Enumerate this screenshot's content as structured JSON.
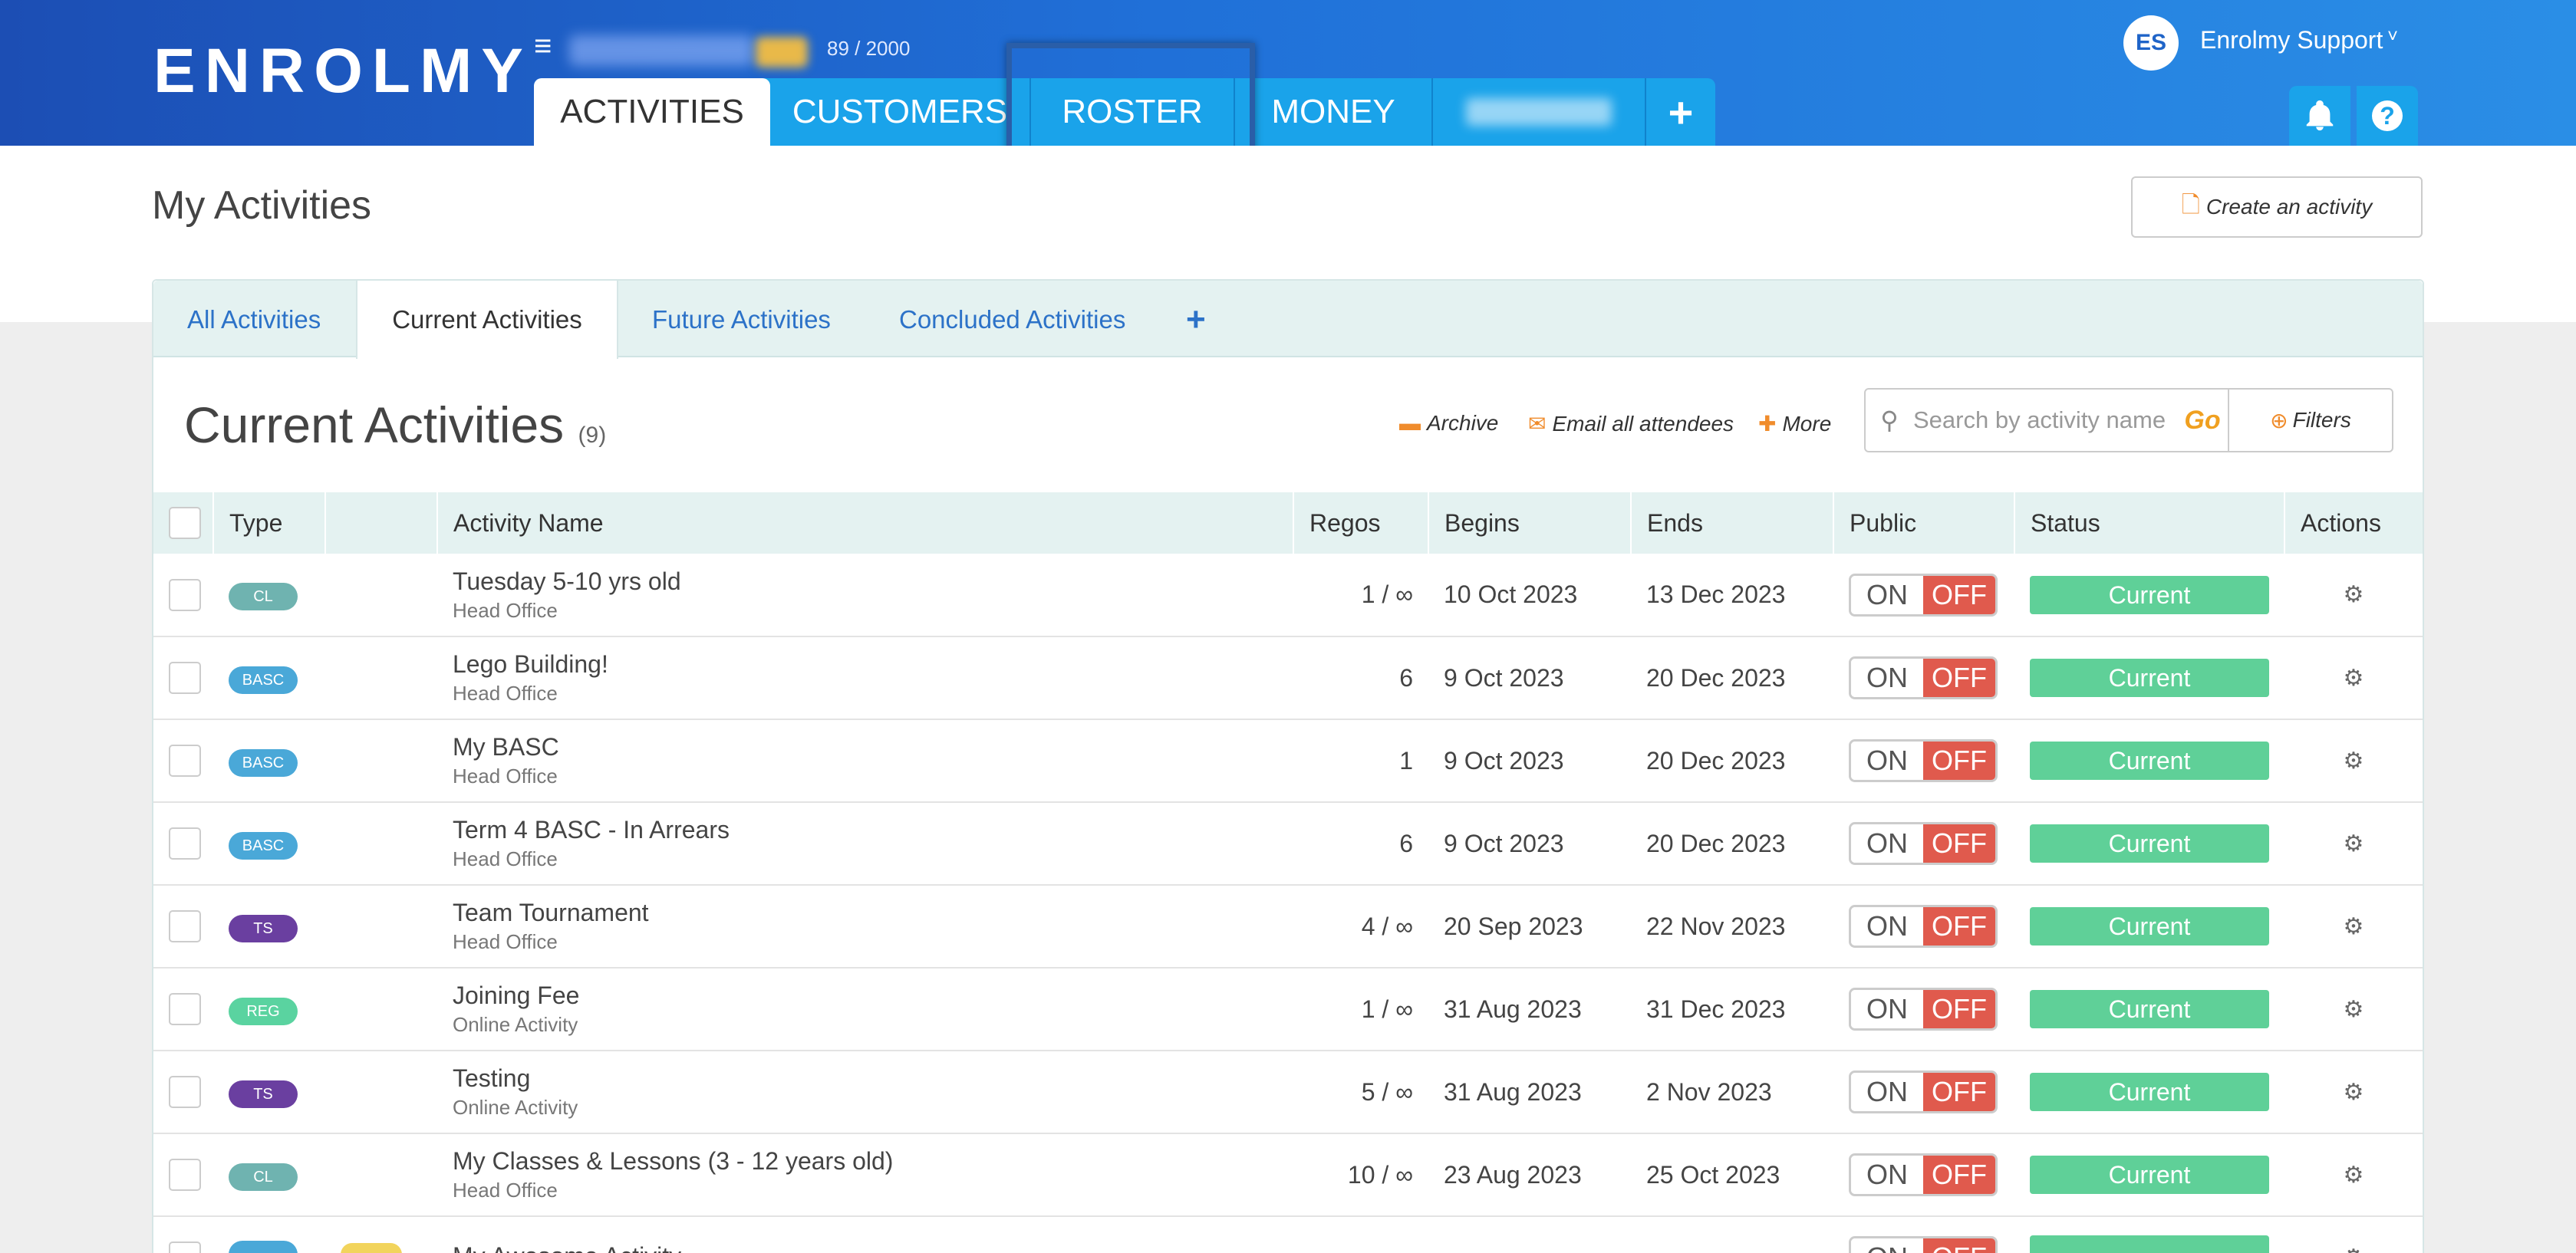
{
  "header": {
    "logo": "ENROLMY",
    "org_count": "89 / 2000",
    "nav_tabs": [
      "ACTIVITIES",
      "CUSTOMERS",
      "ROSTER",
      "MONEY"
    ],
    "add_tab": "+",
    "user_initials": "ES",
    "user_name": "Enrolmy Support",
    "caret": "˅"
  },
  "page": {
    "title": "My Activities",
    "create_button": "Create an activity"
  },
  "subtabs": [
    "All Activities",
    "Current Activities",
    "Future Activities",
    "Concluded Activities"
  ],
  "subtab_add": "+",
  "list": {
    "title": "Current Activities",
    "count": "(9)",
    "archive": "Archive",
    "email_all": "Email all attendees",
    "more": "More",
    "search_placeholder": "Search by activity name",
    "go": "Go",
    "filters": "Filters"
  },
  "table": {
    "columns": [
      "Type",
      "",
      "Activity Name",
      "Regos",
      "Begins",
      "Ends",
      "Public",
      "Status",
      "Actions"
    ],
    "toggle_on": "ON",
    "toggle_off": "OFF",
    "rows": [
      {
        "type": "CL",
        "type_color": "#6fb3b0",
        "name": "Tuesday 5-10 yrs old",
        "location": "Head Office",
        "regos": "1 / ∞",
        "begins": "10 Oct 2023",
        "ends": "13 Dec 2023",
        "status": "Current"
      },
      {
        "type": "BASC",
        "type_color": "#4aa8d8",
        "name": "Lego Building!",
        "location": "Head Office",
        "regos": "6",
        "begins": "9 Oct 2023",
        "ends": "20 Dec 2023",
        "status": "Current"
      },
      {
        "type": "BASC",
        "type_color": "#4aa8d8",
        "name": "My BASC",
        "location": "Head Office",
        "regos": "1",
        "begins": "9 Oct 2023",
        "ends": "20 Dec 2023",
        "status": "Current"
      },
      {
        "type": "BASC",
        "type_color": "#4aa8d8",
        "name": "Term 4 BASC - In Arrears",
        "location": "Head Office",
        "regos": "6",
        "begins": "9 Oct 2023",
        "ends": "20 Dec 2023",
        "status": "Current"
      },
      {
        "type": "TS",
        "type_color": "#6a3fa0",
        "name": "Team Tournament",
        "location": "Head Office",
        "regos": "4 / ∞",
        "begins": "20 Sep 2023",
        "ends": "22 Nov 2023",
        "status": "Current"
      },
      {
        "type": "REG",
        "type_color": "#5ad3a0",
        "name": "Joining Fee",
        "location": "Online Activity",
        "regos": "1 / ∞",
        "begins": "31 Aug 2023",
        "ends": "31 Dec 2023",
        "status": "Current"
      },
      {
        "type": "TS",
        "type_color": "#6a3fa0",
        "name": "Testing",
        "location": "Online Activity",
        "regos": "5 / ∞",
        "begins": "31 Aug 2023",
        "ends": "2 Nov 2023",
        "status": "Current"
      },
      {
        "type": "CL",
        "type_color": "#6fb3b0",
        "name": "My Classes & Lessons (3 - 12 years old)",
        "location": "Head Office",
        "regos": "10 / ∞",
        "begins": "23 Aug 2023",
        "ends": "25 Oct 2023",
        "status": "Current"
      },
      {
        "type": "",
        "type_color": "#4aa8d8",
        "name": "My Awesome Activity",
        "location": "",
        "regos": "",
        "begins": "",
        "ends": "",
        "status": ""
      }
    ]
  },
  "icons": {
    "menu": "hamburger-icon",
    "bell": "bell-icon",
    "help": "help-icon",
    "document": "document-icon",
    "archive": "archive-icon",
    "email": "envelope-icon",
    "plus": "plus-icon",
    "search": "search-icon",
    "gear": "gear-icon"
  },
  "colors": {
    "header_start": "#1c4eb4",
    "header_end": "#2a8ee6",
    "nav_tab": "#1aa3ea",
    "accent_orange": "#f08c2c",
    "status_green": "#5fd098",
    "toggle_off": "#e05a4d",
    "tab_bg": "#e4f2f1",
    "link_blue": "#2c72c8"
  }
}
